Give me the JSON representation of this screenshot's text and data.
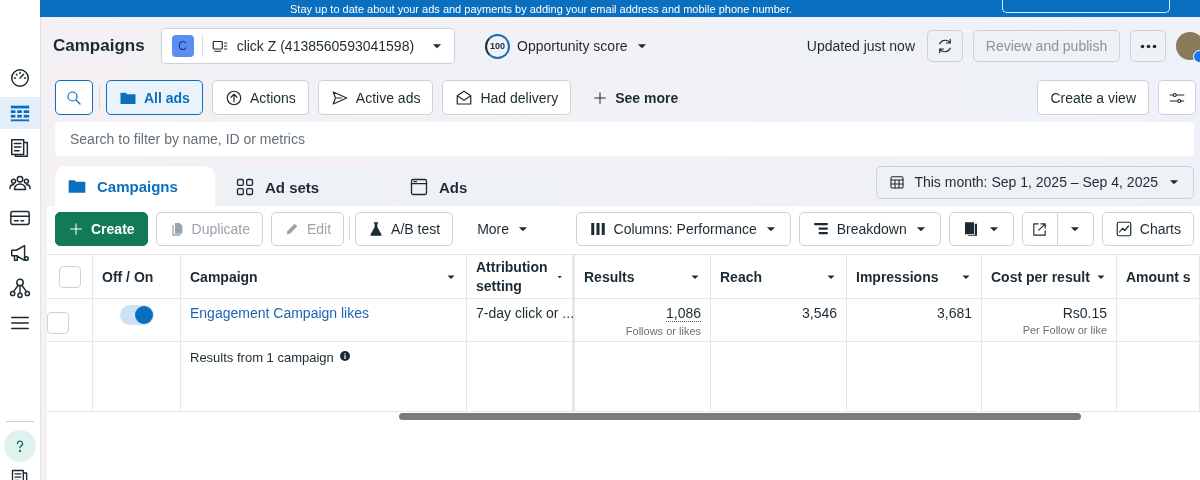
{
  "banner": {
    "text": "Stay up to date about your ads and payments by adding your email address and mobile phone number."
  },
  "sidebar": {
    "items": [
      {
        "kind": "gauge",
        "selected": false
      },
      {
        "kind": "table",
        "selected": true
      },
      {
        "kind": "pages",
        "selected": false
      },
      {
        "kind": "people",
        "selected": false
      },
      {
        "kind": "card",
        "selected": false
      },
      {
        "kind": "megaphone",
        "selected": false
      },
      {
        "kind": "network",
        "selected": false
      },
      {
        "kind": "menu",
        "selected": false
      }
    ],
    "bottom": [
      {
        "kind": "help",
        "selected": false
      },
      {
        "kind": "pages",
        "selected": false
      }
    ]
  },
  "header": {
    "title": "Campaigns",
    "account": {
      "initial": "C",
      "name": "click Z (4138560593041598)"
    },
    "opportunity": {
      "score": "100",
      "label": "Opportunity score"
    },
    "updated": "Updated just now",
    "publish": {
      "label": "Review and publish",
      "disabled": true
    }
  },
  "filters": {
    "chips": [
      {
        "label": "All ads",
        "kind": "folder",
        "selected": true
      },
      {
        "label": "Actions",
        "kind": "upload",
        "selected": false
      },
      {
        "label": "Active ads",
        "kind": "send",
        "selected": false
      },
      {
        "label": "Had delivery",
        "kind": "mail",
        "selected": false
      }
    ],
    "see_more": "See more",
    "create_view": "Create a view"
  },
  "search": {
    "placeholder": "Search to filter by name, ID or metrics"
  },
  "tabs": [
    {
      "label": "Campaigns",
      "kind": "folder",
      "selected": true
    },
    {
      "label": "Ad sets",
      "kind": "grid",
      "selected": false
    },
    {
      "label": "Ads",
      "kind": "window",
      "selected": false
    }
  ],
  "date_range": "This month: Sep 1, 2025 – Sep 4, 2025",
  "toolbar": {
    "left": [
      {
        "label": "Create",
        "kind": "create",
        "disabled": false
      },
      {
        "label": "Duplicate",
        "kind": "duplicate",
        "disabled": true
      },
      {
        "label": "Edit",
        "kind": "edit",
        "disabled": true
      },
      {
        "label": "A/B test",
        "kind": "flask",
        "disabled": false
      },
      {
        "label": "More",
        "kind": "more",
        "disabled": false
      }
    ],
    "right": [
      {
        "label": "Columns: Performance",
        "kind": "columns"
      },
      {
        "label": "Breakdown",
        "kind": "breakdown"
      },
      {
        "kind": "reports"
      },
      {
        "kind": "export"
      },
      {
        "label": "Charts",
        "kind": "charts"
      }
    ]
  },
  "table": {
    "all_selected": false,
    "columns": [
      {
        "label": "Off / On",
        "sortable": false
      },
      {
        "label": "Campaign",
        "sortable": true
      },
      {
        "label": "Attribution setting",
        "sortable": true
      },
      {
        "label": "Results",
        "sortable": true
      },
      {
        "label": "Reach",
        "sortable": true
      },
      {
        "label": "Impressions",
        "sortable": true
      },
      {
        "label": "Cost per result",
        "sortable": true
      },
      {
        "label": "Amount s"
      }
    ],
    "rows": [
      {
        "selected": false,
        "on": true,
        "campaign": "Engagement Campaign likes",
        "attribution": "7-day click or ...",
        "results": "1,086",
        "results_note": "Follows or likes",
        "reach": "3,546",
        "impressions": "3,681",
        "cost": "Rs0.15",
        "cost_note": "Per Follow or like"
      }
    ],
    "summary": "Results from 1 campaign"
  }
}
